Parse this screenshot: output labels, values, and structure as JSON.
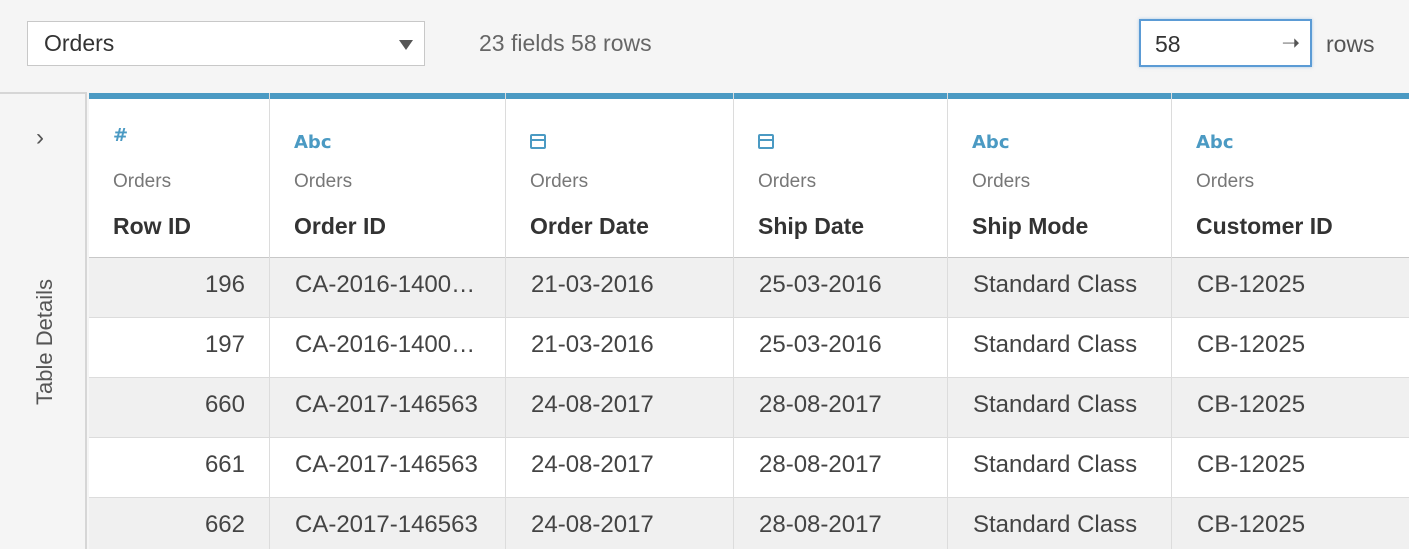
{
  "toolbar": {
    "table_select": "Orders",
    "summary": "23 fields 58 rows",
    "rows_value": "58",
    "rows_label": "rows"
  },
  "sidebar": {
    "label": "Table Details",
    "expand_icon": "chevron-right-icon"
  },
  "columns": [
    {
      "icon": "number-icon",
      "icon_text": "#",
      "source": "Orders",
      "name": "Row ID"
    },
    {
      "icon": "string-icon",
      "icon_text": "Abc",
      "source": "Orders",
      "name": "Order ID"
    },
    {
      "icon": "calendar-icon",
      "icon_text": "",
      "source": "Orders",
      "name": "Order Date"
    },
    {
      "icon": "calendar-icon",
      "icon_text": "",
      "source": "Orders",
      "name": "Ship Date"
    },
    {
      "icon": "string-icon",
      "icon_text": "Abc",
      "source": "Orders",
      "name": "Ship Mode"
    },
    {
      "icon": "string-icon",
      "icon_text": "Abc",
      "source": "Orders",
      "name": "Customer ID"
    }
  ],
  "rows": [
    [
      "196",
      "CA-2016-1400…",
      "21-03-2016",
      "25-03-2016",
      "Standard Class",
      "CB-12025"
    ],
    [
      "197",
      "CA-2016-1400…",
      "21-03-2016",
      "25-03-2016",
      "Standard Class",
      "CB-12025"
    ],
    [
      "660",
      "CA-2017-146563",
      "24-08-2017",
      "28-08-2017",
      "Standard Class",
      "CB-12025"
    ],
    [
      "661",
      "CA-2017-146563",
      "24-08-2017",
      "28-08-2017",
      "Standard Class",
      "CB-12025"
    ],
    [
      "662",
      "CA-2017-146563",
      "24-08-2017",
      "28-08-2017",
      "Standard Class",
      "CB-12025"
    ]
  ],
  "colors": {
    "accent": "#4b9ac3",
    "input_border": "#5b9bd5"
  }
}
